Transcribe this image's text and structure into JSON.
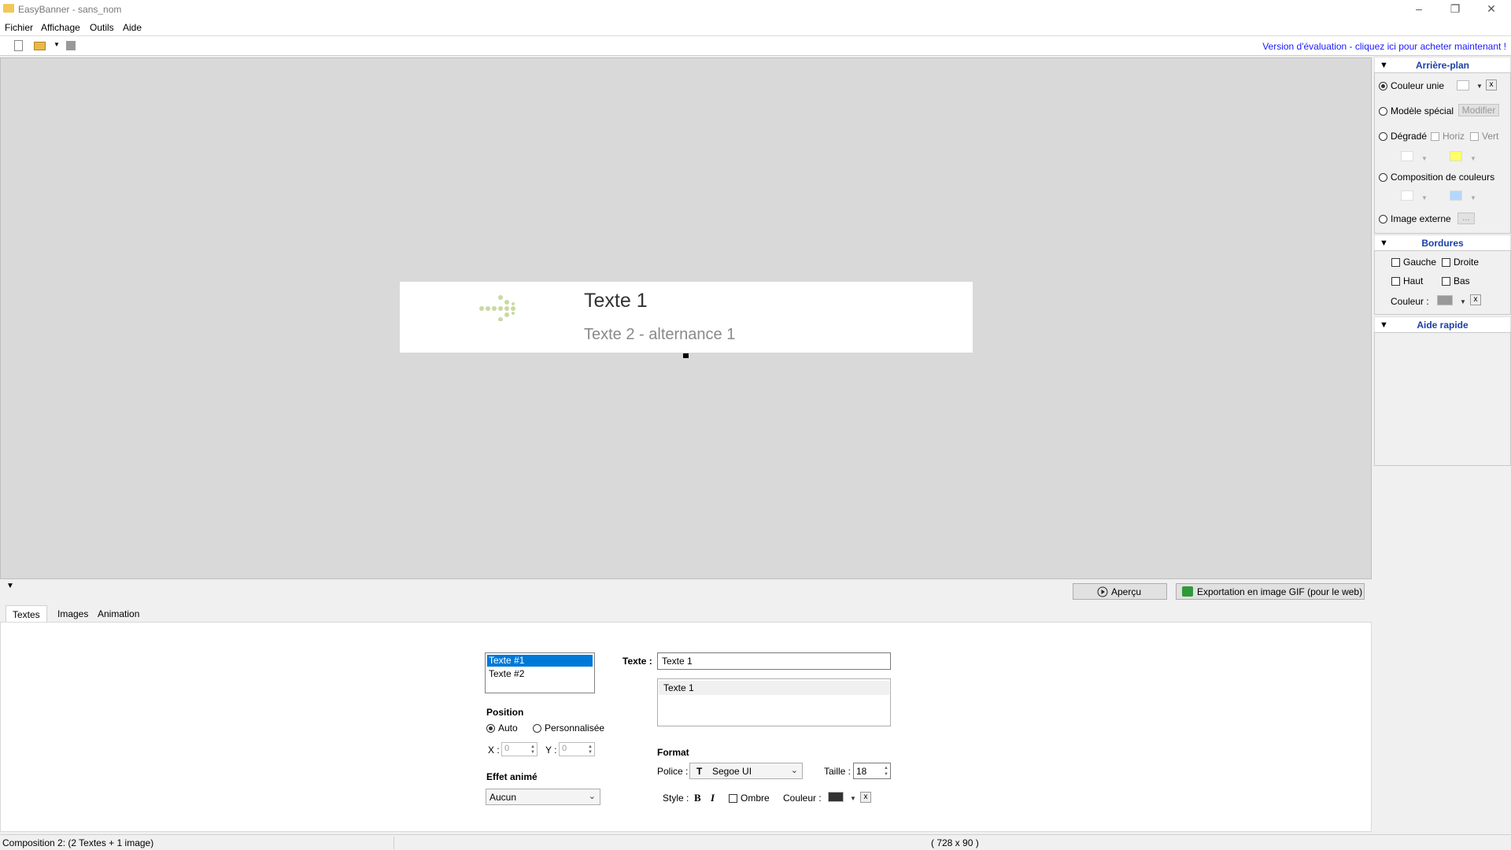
{
  "window": {
    "title": "EasyBanner - sans_nom",
    "minimize": "–",
    "restore": "❐",
    "close": "✕"
  },
  "menu": [
    "Fichier",
    "Affichage",
    "Outils",
    "Aide"
  ],
  "toolbar": {
    "eval_link": "Version d'évaluation - cliquez ici pour acheter maintenant !"
  },
  "banner": {
    "text1": "Texte 1",
    "text2": "Texte 2 - alternance 1"
  },
  "background_panel": {
    "title": "Arrière-plan",
    "solid_color": "Couleur unie",
    "special_model": "Modèle spécial",
    "modify": "Modifier",
    "gradient": "Dégradé",
    "horiz": "Horiz",
    "vert": "Vert",
    "color_composition": "Composition de couleurs",
    "external_image": "Image externe",
    "browse": "...",
    "selected": "Couleur unie",
    "colors": {
      "solid": "#ffffff",
      "gradient_from": "#ffffff",
      "gradient_to": "#ffff66",
      "composition_from": "#ffffff",
      "composition_to": "#b3d7ff"
    }
  },
  "borders_panel": {
    "title": "Bordures",
    "left": "Gauche",
    "right": "Droite",
    "top": "Haut",
    "bottom": "Bas",
    "color_label": "Couleur :",
    "color": "#999999"
  },
  "quick_help": {
    "title": "Aide rapide"
  },
  "actions": {
    "preview": "Aperçu",
    "export": "Exportation en image GIF (pour le web)"
  },
  "tabs": [
    "Textes",
    "Images",
    "Animation"
  ],
  "texts_tab": {
    "list": [
      "Texte #1",
      "Texte #2"
    ],
    "selected_index": 0,
    "position_label": "Position",
    "auto": "Auto",
    "custom": "Personnalisée",
    "x_label": "X :",
    "x_value": "0",
    "y_label": "Y :",
    "y_value": "0",
    "effect_label": "Effet animé",
    "effect_value": "Aucun",
    "text_label": "Texte :",
    "text_value": "Texte 1",
    "alternates": [
      "Texte 1"
    ],
    "format_label": "Format",
    "font_label": "Police :",
    "font_value": "Segoe UI",
    "size_label": "Taille :",
    "size_value": "18",
    "style_label": "Style :",
    "bold": "B",
    "italic": "I",
    "shadow": "Ombre",
    "color_label": "Couleur :",
    "color": "#333333",
    "clear": "x"
  },
  "status": {
    "left": "Composition 2:  (2 Textes + 1 image)",
    "size": "( 728 x 90 )"
  }
}
